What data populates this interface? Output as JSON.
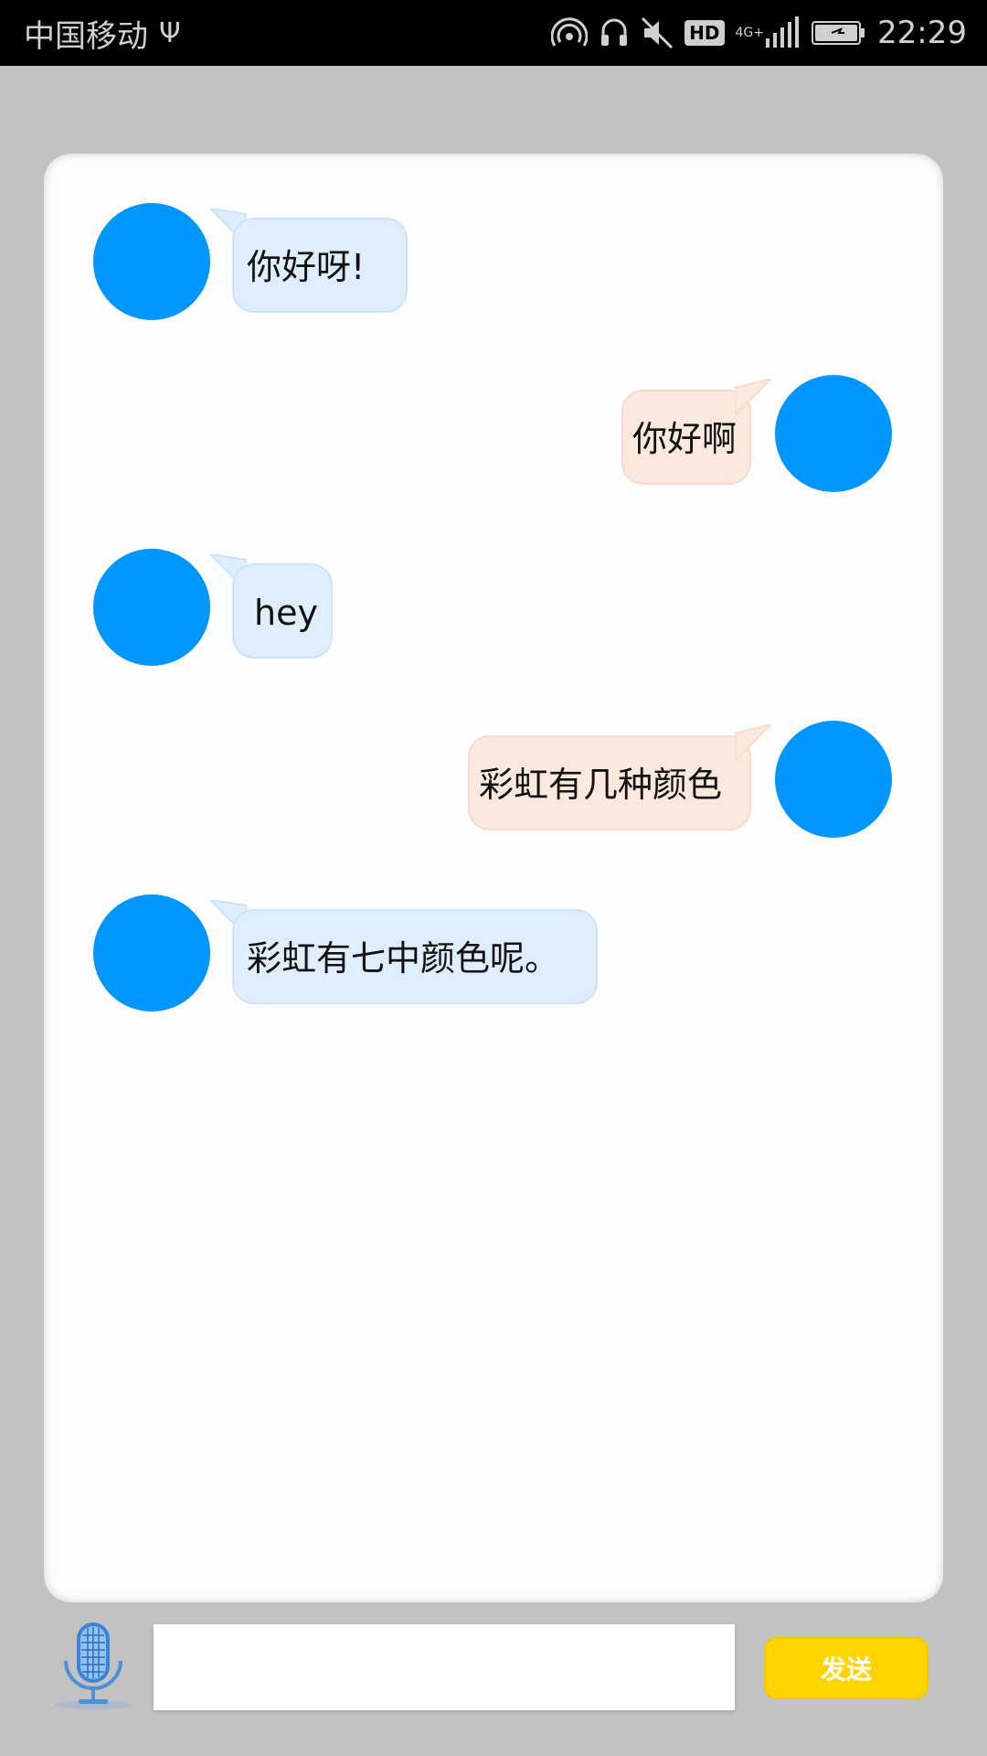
{
  "status_bar": {
    "carrier": "中国移动",
    "usb_icon": "usb-icon",
    "network_badge": "HD",
    "network_type": "4G+",
    "time": "22:29",
    "icons": [
      "hotspot-icon",
      "headset-icon",
      "mute-icon",
      "hd-icon",
      "signal-icon",
      "battery-icon"
    ]
  },
  "chat": {
    "messages": [
      {
        "side": "left",
        "text": "你好呀!"
      },
      {
        "side": "right",
        "text": "你好啊"
      },
      {
        "side": "left",
        "text": "hey"
      },
      {
        "side": "right",
        "text": "彩虹有几种颜色"
      },
      {
        "side": "left",
        "text": "彩虹有七中颜色呢。"
      }
    ]
  },
  "input_bar": {
    "mic_icon": "microphone-icon",
    "input_value": "",
    "send_label": "发送"
  },
  "colors": {
    "avatar": "#0096ff",
    "left_bubble": "#dfeefc",
    "right_bubble": "#fbe9de",
    "send_button": "#ffd400",
    "background": "#c2c2c2"
  }
}
